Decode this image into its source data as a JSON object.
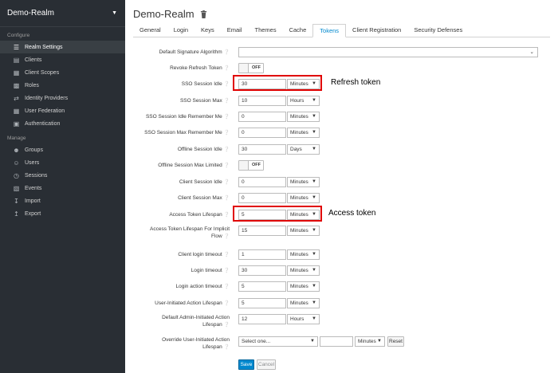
{
  "sidebar": {
    "realm": "Demo-Realm",
    "configure_label": "Configure",
    "manage_label": "Manage",
    "configure_items": [
      {
        "label": "Realm Settings",
        "icon": "sliders-icon",
        "active": true
      },
      {
        "label": "Clients",
        "icon": "cube-icon"
      },
      {
        "label": "Client Scopes",
        "icon": "scopes-icon"
      },
      {
        "label": "Roles",
        "icon": "roles-icon"
      },
      {
        "label": "Identity Providers",
        "icon": "exchange-icon"
      },
      {
        "label": "User Federation",
        "icon": "database-icon"
      },
      {
        "label": "Authentication",
        "icon": "lock-icon"
      }
    ],
    "manage_items": [
      {
        "label": "Groups",
        "icon": "users-icon"
      },
      {
        "label": "Users",
        "icon": "user-icon"
      },
      {
        "label": "Sessions",
        "icon": "clock-icon"
      },
      {
        "label": "Events",
        "icon": "calendar-icon"
      },
      {
        "label": "Import",
        "icon": "import-icon"
      },
      {
        "label": "Export",
        "icon": "export-icon"
      }
    ]
  },
  "header": {
    "title": "Demo-Realm"
  },
  "tabs": [
    "General",
    "Login",
    "Keys",
    "Email",
    "Themes",
    "Cache",
    "Tokens",
    "Client Registration",
    "Security Defenses"
  ],
  "active_tab": "Tokens",
  "form": {
    "default_signature_algorithm": "Default Signature Algorithm",
    "revoke_refresh_token": "Revoke Refresh Token",
    "revoke_toggle": "OFF",
    "sso_session_idle": {
      "label": "SSO Session Idle",
      "value": "30",
      "unit": "Minutes"
    },
    "sso_session_max": {
      "label": "SSO Session Max",
      "value": "10",
      "unit": "Hours"
    },
    "sso_idle_remember": {
      "label": "SSO Session Idle Remember Me",
      "value": "0",
      "unit": "Minutes"
    },
    "sso_max_remember": {
      "label": "SSO Session Max Remember Me",
      "value": "0",
      "unit": "Minutes"
    },
    "offline_idle": {
      "label": "Offline Session Idle",
      "value": "30",
      "unit": "Days"
    },
    "offline_max_limited": {
      "label": "Offline Session Max Limited",
      "toggle": "OFF"
    },
    "client_idle": {
      "label": "Client Session Idle",
      "value": "0",
      "unit": "Minutes"
    },
    "client_max": {
      "label": "Client Session Max",
      "value": "0",
      "unit": "Minutes"
    },
    "access_lifespan": {
      "label": "Access Token Lifespan",
      "value": "5",
      "unit": "Minutes"
    },
    "access_implicit": {
      "label1": "Access Token Lifespan For Implicit",
      "label2": "Flow",
      "value": "15",
      "unit": "Minutes"
    },
    "client_login_timeout": {
      "label": "Client login timeout",
      "value": "1",
      "unit": "Minutes"
    },
    "login_timeout": {
      "label": "Login timeout",
      "value": "30",
      "unit": "Minutes"
    },
    "login_action_timeout": {
      "label": "Login action timeout",
      "value": "5",
      "unit": "Minutes"
    },
    "user_action_lifespan": {
      "label": "User-Initiated Action Lifespan",
      "value": "5",
      "unit": "Minutes"
    },
    "admin_action_lifespan": {
      "label1": "Default Admin-Initiated Action",
      "label2": "Lifespan",
      "value": "12",
      "unit": "Hours"
    },
    "override_action": {
      "label1": "Override User-Initiated Action",
      "label2": "Lifespan",
      "select_placeholder": "Select one...",
      "unit": "Minutes",
      "reset": "Reset"
    }
  },
  "buttons": {
    "save": "Save",
    "cancel": "Cancel"
  },
  "annotations": {
    "refresh": "Refresh token",
    "access": "Access token"
  },
  "colors": {
    "sidebar_bg": "#292e34",
    "accent": "#0088ce",
    "highlight": "#e00000"
  }
}
